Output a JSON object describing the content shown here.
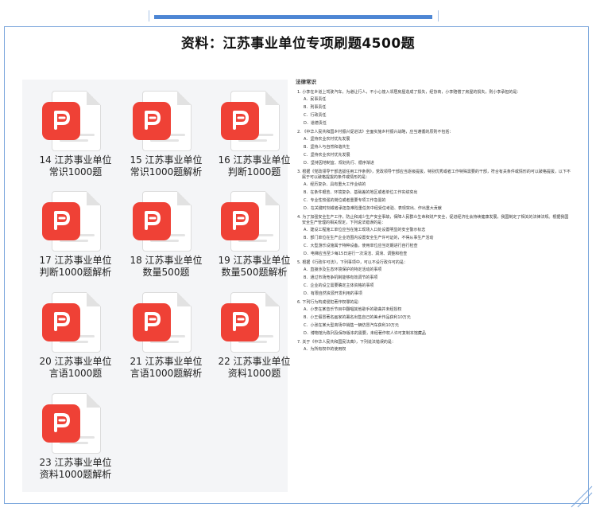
{
  "title": "资料：江苏事业单位专项刷题4500题",
  "files": [
    {
      "name_line1": "14 江苏事业单位",
      "name_line2": "常识1000题"
    },
    {
      "name_line1": "15 江苏事业单位",
      "name_line2": "常识1000题解析"
    },
    {
      "name_line1": "16 江苏事业单位",
      "name_line2": "判断1000题"
    },
    {
      "name_line1": "17 江苏事业单位",
      "name_line2": "判断1000题解析"
    },
    {
      "name_line1": "18 江苏事业单位",
      "name_line2": "数量500题"
    },
    {
      "name_line1": "19 江苏事业单位",
      "name_line2": "数量500题解析"
    },
    {
      "name_line1": "20 江苏事业单位",
      "name_line2": "言语1000题"
    },
    {
      "name_line1": "21 江苏事业单位",
      "name_line2": "言语1000题解析"
    },
    {
      "name_line1": "22 江苏事业单位",
      "name_line2": "资料1000题"
    },
    {
      "name_line1": "23 江苏事业单位",
      "name_line2": "资料1000题解析"
    }
  ],
  "preview": {
    "heading": "法律常识",
    "questions": [
      {
        "q": "1. 小李在乡道上驾驶汽车，为避让行人，不小心撞入邻居房屋造成了损失，经协商，小李赔偿了房屋的损失，则小李承担的是：",
        "options": [
          "A．民事责任",
          "B．刑事责任",
          "C．行政责任",
          "D．道德责任"
        ]
      },
      {
        "q": "2. 《中华人民共和国乡村振兴促进法》全面实施乡村振兴战略，应当遵循的原则不包括：",
        "options": [
          "A．坚持农业农村优先发展",
          "B．坚持人与自然和谐共生",
          "C．坚持农业农村优先发展",
          "D．坚持因地制宜、规划先行、循序渐进"
        ]
      },
      {
        "q": "3. 根据《党政领导干部选拔任用工作条例》，党政领导干部应当逐级提拔，特别优秀或者工作特殊需要的干部，符合有关条件或情形的可以破格提拔，以下不属于可以破格提拔的条件或情形的是：",
        "options": [
          "A．经历复杂、具有重大工作业绩的",
          "B．在条件艰苦、环境复杂、基础差的地区或者单位工作实绩突出",
          "C．专业性较强的岗位或者重要专项工作急需的",
          "D．在关键时刻或者承担急难险重任务中经受住考验、表现突出、作出重大贡献"
        ]
      },
      {
        "q": "4. 为了加强安全生产工作，防止和减少生产安全事故，保障人民群众生命和财产安全，促进经济社会持续健康发展，我国制定了相关的法律法规。根据我国安全生产管理的相关规定，下列说法错误的是：",
        "options": [
          "A．建设工程施工单位应当在施工现场入口处设置明显的安全警示标志",
          "B．部门单位在生产企业范围内设置安全生产许可证的，不得从事生产活动",
          "C．大型游乐设施属于特种设备，使用单位应当定期进行自行检查",
          "D．电梯应当至少每15日进行一次清洁、润滑、调整和检查"
        ]
      },
      {
        "q": "5. 根据《行政许可法》，下列事项中，可以不设行政许可的是：",
        "options": [
          "A．直接涉及生态环境保护的特定活动的事项",
          "B．通过市场竞争机制能够有效调节的事项",
          "C．企业的设立需要确定主体资格的事项",
          "D．有限自然资源开发利用的事项"
        ]
      },
      {
        "q": "6. 下列行为构成侵犯著作权罪的是：",
        "options": [
          "A．小李在某音乐节目中翻唱其他歌手的歌曲并未经授权",
          "B．小王假冒著名画家的署名出售自己的美术作品获利10万元",
          "C．小张在某大型商场中销售一辆仿冒汽车获利10万元",
          "D．博物馆为陈列及保存版本的需要，未经著作权人许可复制本馆藏品"
        ]
      },
      {
        "q": "7. 关于《中华人民共和国民法典》，下列说法错误的是：",
        "options": [
          "A．为所有权中的使用权"
        ]
      }
    ]
  }
}
